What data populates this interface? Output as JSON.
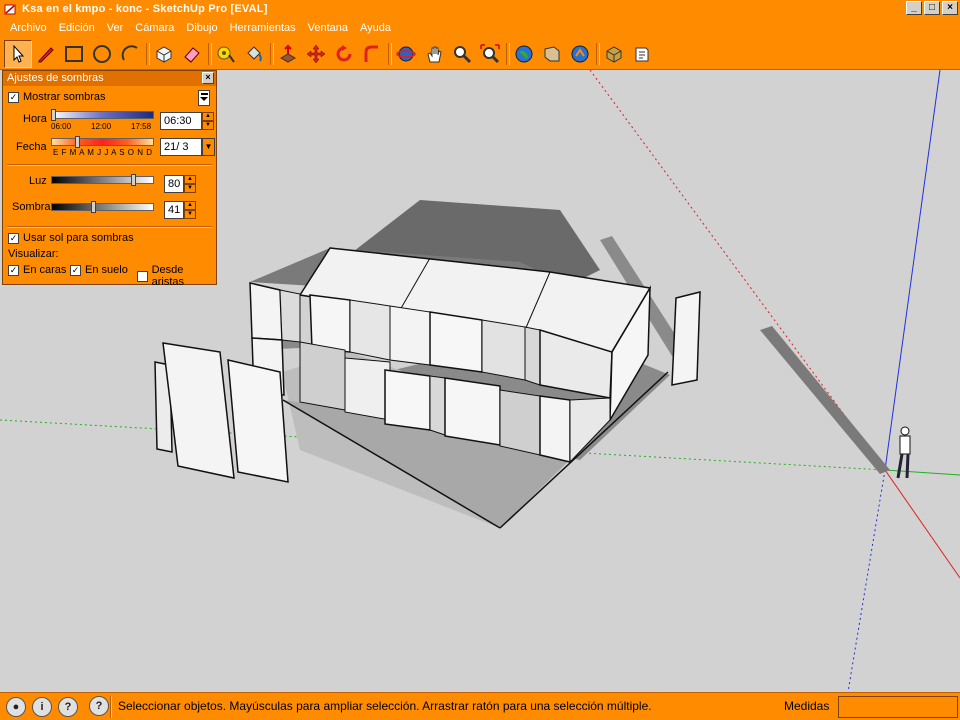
{
  "window": {
    "title": "Ksa en el kmpo - konc - SketchUp Pro [EVAL]",
    "min": "_",
    "max": "□",
    "close": "×"
  },
  "menu": {
    "items": [
      "Archivo",
      "Edición",
      "Ver",
      "Cámara",
      "Dibujo",
      "Herramientas",
      "Ventana",
      "Ayuda"
    ]
  },
  "toolbar": {
    "tools": [
      "select-tool",
      "pencil-tool",
      "rectangle-tool",
      "circle-tool",
      "arc-tool",
      "eraser-tool",
      "paint-tool",
      "tape-tool",
      "bucket-tool",
      "push-pull-tool",
      "move-tool",
      "rotate-tool",
      "follow-me-tool",
      "orbit-tool",
      "pan-tool",
      "zoom-tool",
      "zoom-extents-tool",
      "get-models-tool",
      "share-model-tool",
      "google-earth-tool",
      "components-tool",
      "section-tool"
    ]
  },
  "shadow_panel": {
    "title": "Ajustes de sombras",
    "close": "×",
    "show_shadows": {
      "label": "Mostrar sombras",
      "checked": true
    },
    "hour": {
      "label": "Hora",
      "ticks": [
        "06:00",
        "12:00",
        "17:58"
      ],
      "value": "06:30"
    },
    "date": {
      "label": "Fecha",
      "months": "E F M A M J J A S O N D",
      "value": "21/ 3"
    },
    "light": {
      "label": "Luz",
      "value": "80"
    },
    "shade": {
      "label": "Sombra",
      "value": "41"
    },
    "use_sun": {
      "label": "Usar sol para sombras",
      "checked": true
    },
    "visualize_label": "Visualizar:",
    "on_faces": {
      "label": "En caras",
      "checked": true
    },
    "on_ground": {
      "label": "En suelo",
      "checked": true
    },
    "from_edges": {
      "label": "Desde aristas",
      "checked": false
    }
  },
  "status": {
    "text": "Seleccionar objetos. Mayúsculas para ampliar selección. Arrastrar ratón para una selección múltiple.",
    "measures_label": "Medidas",
    "measures_value": ""
  }
}
